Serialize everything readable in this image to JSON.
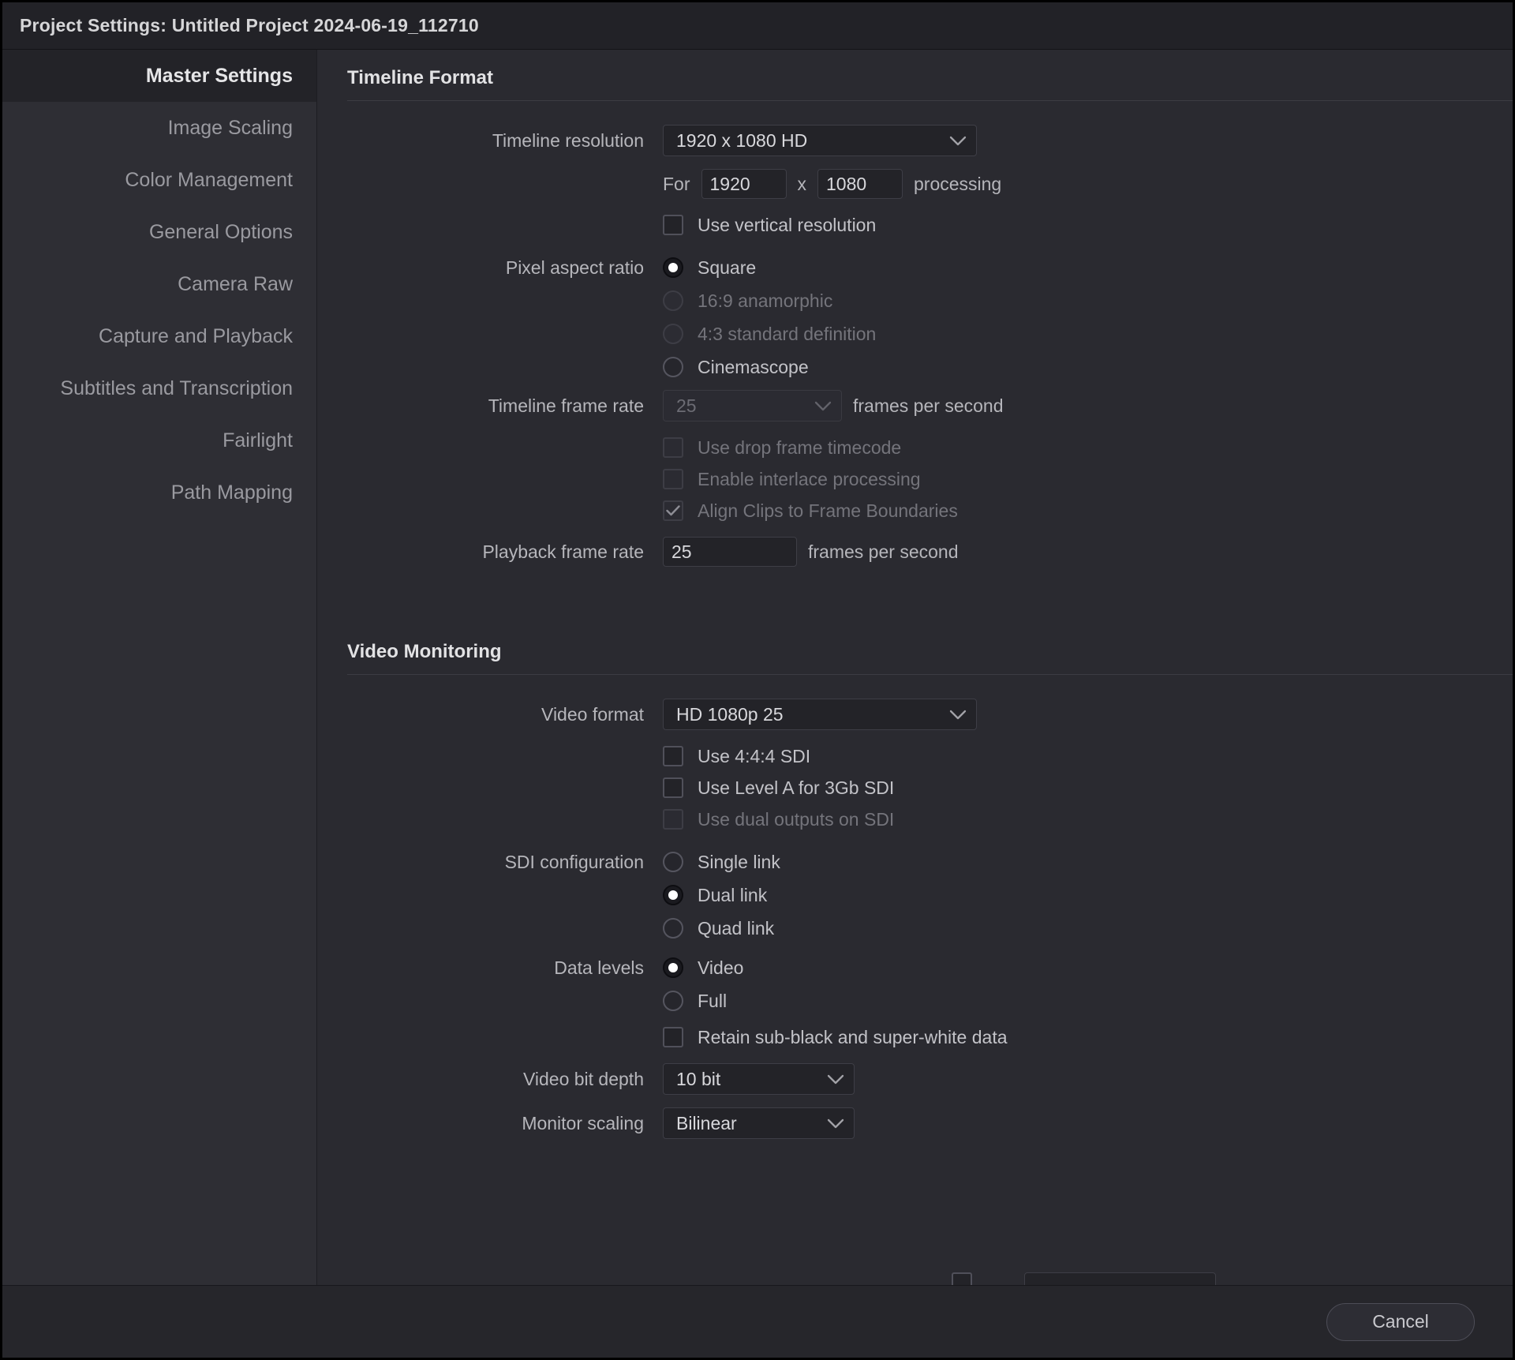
{
  "window": {
    "title_prefix": "Project Settings:",
    "project_name": "Untitled Project 2024-06-19_112710",
    "title": "Project Settings:  Untitled Project 2024-06-19_112710"
  },
  "sidebar": {
    "items": [
      {
        "label": "Master Settings",
        "active": true
      },
      {
        "label": "Image Scaling",
        "active": false
      },
      {
        "label": "Color Management",
        "active": false
      },
      {
        "label": "General Options",
        "active": false
      },
      {
        "label": "Camera Raw",
        "active": false
      },
      {
        "label": "Capture and Playback",
        "active": false
      },
      {
        "label": "Subtitles and Transcription",
        "active": false
      },
      {
        "label": "Fairlight",
        "active": false
      },
      {
        "label": "Path Mapping",
        "active": false
      }
    ]
  },
  "timeline_format": {
    "heading": "Timeline Format",
    "timeline_resolution": {
      "label": "Timeline resolution",
      "value": "1920 x 1080 HD"
    },
    "processing": {
      "for_label": "For",
      "width": "1920",
      "x_label": "x",
      "height": "1080",
      "suffix_label": "processing"
    },
    "use_vertical_resolution": {
      "label": "Use vertical resolution",
      "checked": false,
      "enabled": true
    },
    "pixel_aspect_ratio": {
      "label": "Pixel aspect ratio",
      "options": [
        {
          "label": "Square",
          "selected": true,
          "enabled": true
        },
        {
          "label": "16:9 anamorphic",
          "selected": false,
          "enabled": false
        },
        {
          "label": "4:3 standard definition",
          "selected": false,
          "enabled": false
        },
        {
          "label": "Cinemascope",
          "selected": false,
          "enabled": true
        }
      ]
    },
    "timeline_frame_rate": {
      "label": "Timeline frame rate",
      "value": "25",
      "suffix": "frames per second",
      "enabled": false
    },
    "use_drop_frame_timecode": {
      "label": "Use drop frame timecode",
      "checked": false,
      "enabled": false
    },
    "enable_interlace_processing": {
      "label": "Enable interlace processing",
      "checked": false,
      "enabled": false
    },
    "align_clips_to_frame_boundaries": {
      "label": "Align Clips to Frame Boundaries",
      "checked": true,
      "enabled": false
    },
    "playback_frame_rate": {
      "label": "Playback frame rate",
      "value": "25",
      "suffix": "frames per second",
      "enabled": true
    }
  },
  "video_monitoring": {
    "heading": "Video Monitoring",
    "video_format": {
      "label": "Video format",
      "value": "HD 1080p 25"
    },
    "use_444_sdi": {
      "label": "Use 4:4:4 SDI",
      "checked": false,
      "enabled": true
    },
    "use_level_a_3gb_sdi": {
      "label": "Use Level A for 3Gb SDI",
      "checked": false,
      "enabled": true
    },
    "use_dual_outputs_sdi": {
      "label": "Use dual outputs on SDI",
      "checked": false,
      "enabled": false
    },
    "sdi_configuration": {
      "label": "SDI configuration",
      "options": [
        {
          "label": "Single link",
          "selected": false,
          "enabled": true
        },
        {
          "label": "Dual link",
          "selected": true,
          "enabled": true
        },
        {
          "label": "Quad link",
          "selected": false,
          "enabled": true
        }
      ]
    },
    "data_levels": {
      "label": "Data levels",
      "options": [
        {
          "label": "Video",
          "selected": true,
          "enabled": true
        },
        {
          "label": "Full",
          "selected": false,
          "enabled": true
        }
      ]
    },
    "retain_sub_black": {
      "label": "Retain sub-black and super-white data",
      "checked": false,
      "enabled": true
    },
    "video_bit_depth": {
      "label": "Video bit depth",
      "value": "10 bit"
    },
    "monitor_scaling": {
      "label": "Monitor scaling",
      "value": "Bilinear"
    }
  },
  "footer": {
    "cancel_label": "Cancel"
  },
  "colors": {
    "window_bg": "#2a2a30",
    "sidebar_bg": "#2e2e34",
    "titlebar_bg": "#222227",
    "active_item_bg": "#232328",
    "text_primary": "#d6d6d8",
    "text_secondary": "#b6b6bb",
    "text_disabled": "#74747b"
  }
}
